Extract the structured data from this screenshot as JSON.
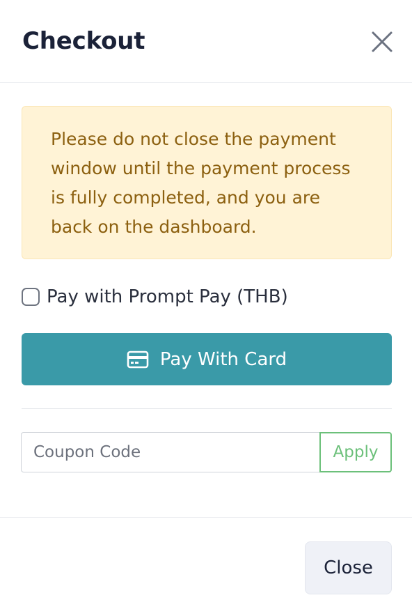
{
  "modal": {
    "title": "Checkout"
  },
  "alert": {
    "message": "Please do not close the payment window until the payment process is fully completed, and you are back on the dashboard.",
    "colors": {
      "background": "#fff3d6",
      "text": "#8c6010"
    }
  },
  "prompt_pay": {
    "label": "Pay with Prompt Pay (THB)",
    "checked": false
  },
  "pay_card": {
    "label": "Pay With Card",
    "icon": "credit-card-icon",
    "color": "#3a9aa8"
  },
  "coupon": {
    "placeholder": "Coupon Code",
    "value": "",
    "apply_label": "Apply",
    "apply_color": "#6cc07a"
  },
  "footer": {
    "close_label": "Close"
  }
}
